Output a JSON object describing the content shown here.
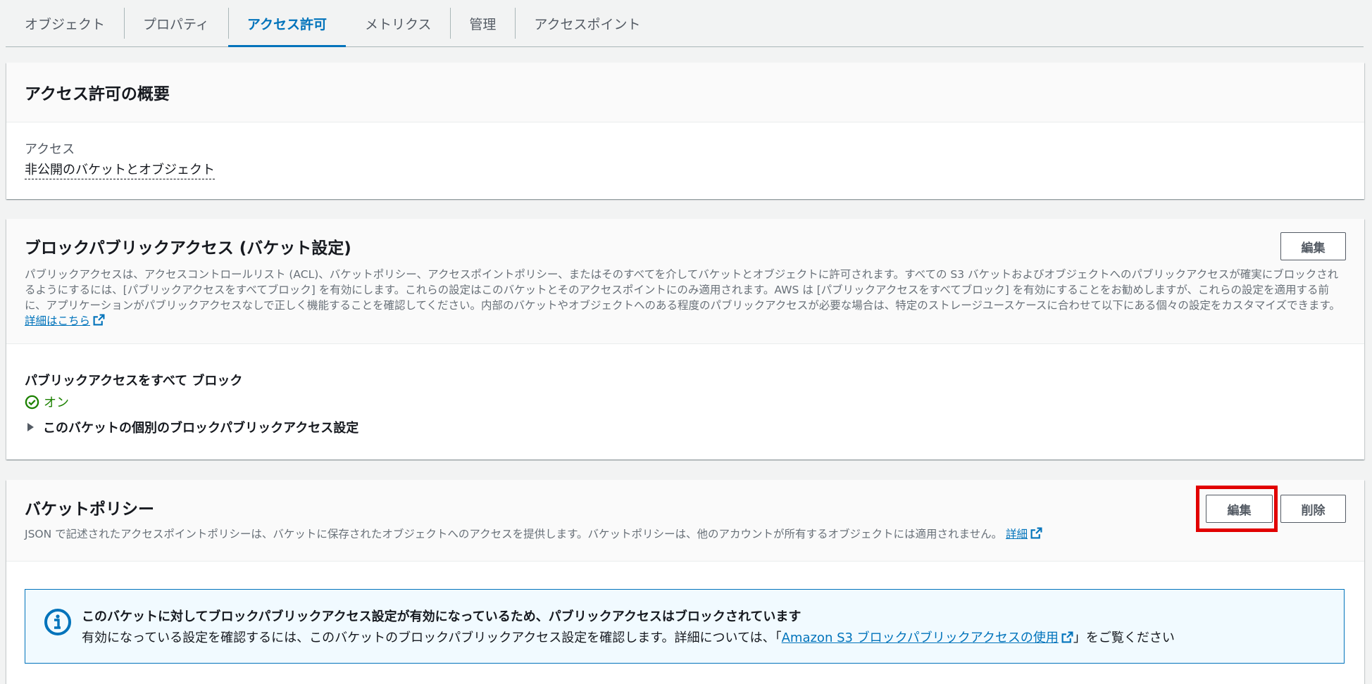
{
  "tabs": [
    {
      "label": "オブジェクト"
    },
    {
      "label": "プロパティ"
    },
    {
      "label": "アクセス許可"
    },
    {
      "label": "メトリクス"
    },
    {
      "label": "管理"
    },
    {
      "label": "アクセスポイント"
    }
  ],
  "active_tab": "アクセス許可",
  "overview": {
    "title": "アクセス許可の概要",
    "access_label": "アクセス",
    "access_value": "非公開のバケットとオブジェクト"
  },
  "block_public": {
    "title": "ブロックパブリックアクセス (バケット設定)",
    "edit_label": "編集",
    "description": "パブリックアクセスは、アクセスコントロールリスト (ACL)、バケットポリシー、アクセスポイントポリシー、またはそのすべてを介してバケットとオブジェクトに許可されます。すべての S3 バケットおよびオブジェクトへのパブリックアクセスが確実にブロックされるようにするには、[パブリックアクセスをすべてブロック] を有効にします。これらの設定はこのバケットとそのアクセスポイントにのみ適用されます。AWS は [パブリックアクセスをすべてブロック] を有効にすることをお勧めしますが、これらの設定を適用する前に、アプリケーションがパブリックアクセスなしで正しく機能することを確認してください。内部のバケットやオブジェクトへのある程度のパブリックアクセスが必要な場合は、特定のストレージユースケースに合わせて以下にある個々の設定をカスタマイズできます。",
    "learn_more_link": "詳細はこちら",
    "setting_label": "パブリックアクセスをすべて ブロック",
    "setting_status": "オン",
    "expander_label": "このバケットの個別のブロックパブリックアクセス設定"
  },
  "bucket_policy": {
    "title": "バケットポリシー",
    "edit_label": "編集",
    "delete_label": "削除",
    "description": "JSON で記述されたアクセスポイントポリシーは、バケットに保存されたオブジェクトへのアクセスを提供します。バケットポリシーは、他のアカウントが所有するオブジェクトには適用されません。",
    "details_link": "詳細",
    "alert": {
      "title": "このバケットに対してブロックパブリックアクセス設定が有効になっているため、パブリックアクセスはブロックされています",
      "text_before": "有効になっている設定を確認するには、このバケットのブロックパブリックアクセス設定を確認します。詳細については、「",
      "link": "Amazon S3 ブロックパブリックアクセスの使用",
      "text_after": "」をご覧ください"
    }
  },
  "colors": {
    "accent": "#0073bb",
    "success": "#1d8102",
    "highlight": "#e10000",
    "alert_bg": "#f1faff"
  },
  "icons": [
    "external-link-icon",
    "check-circle-icon",
    "caret-right-icon",
    "info-icon"
  ]
}
